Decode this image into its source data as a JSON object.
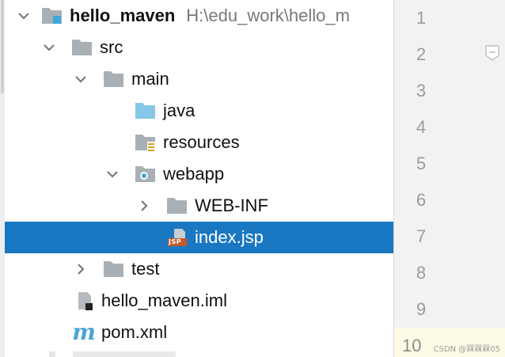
{
  "project_tree": {
    "root": {
      "label": "hello_maven",
      "path": "H:\\edu_work\\hello_m"
    },
    "items": [
      {
        "label": "src"
      },
      {
        "label": "main"
      },
      {
        "label": "java"
      },
      {
        "label": "resources"
      },
      {
        "label": "webapp"
      },
      {
        "label": "WEB-INF"
      },
      {
        "label": "index.jsp"
      },
      {
        "label": "test"
      },
      {
        "label": "hello_maven.iml"
      },
      {
        "label": "pom.xml"
      }
    ],
    "jsp_badge": "JSP",
    "maven_badge": "m",
    "selected_item": "index.jsp"
  },
  "gutter": {
    "line_numbers": [
      "1",
      "2",
      "3",
      "4",
      "5",
      "6",
      "7",
      "8",
      "9",
      "10"
    ]
  },
  "watermark": "CSDN @槑槑槑05",
  "colors": {
    "selection": "#1a78c2",
    "folder": "#a9b0b5",
    "source_folder": "#86c6e6",
    "gutter_bg": "#f2f2f2",
    "current_line": "#fdfbe6"
  },
  "icons": {
    "expanded": "chevron-down-icon",
    "collapsed": "chevron-right-icon",
    "module": "module-folder-icon",
    "folder": "folder-icon",
    "source": "source-folder-icon",
    "resources": "resources-folder-icon",
    "web": "web-folder-icon",
    "jsp": "jsp-file-icon",
    "iml": "iml-file-icon",
    "maven": "maven-pom-icon"
  }
}
